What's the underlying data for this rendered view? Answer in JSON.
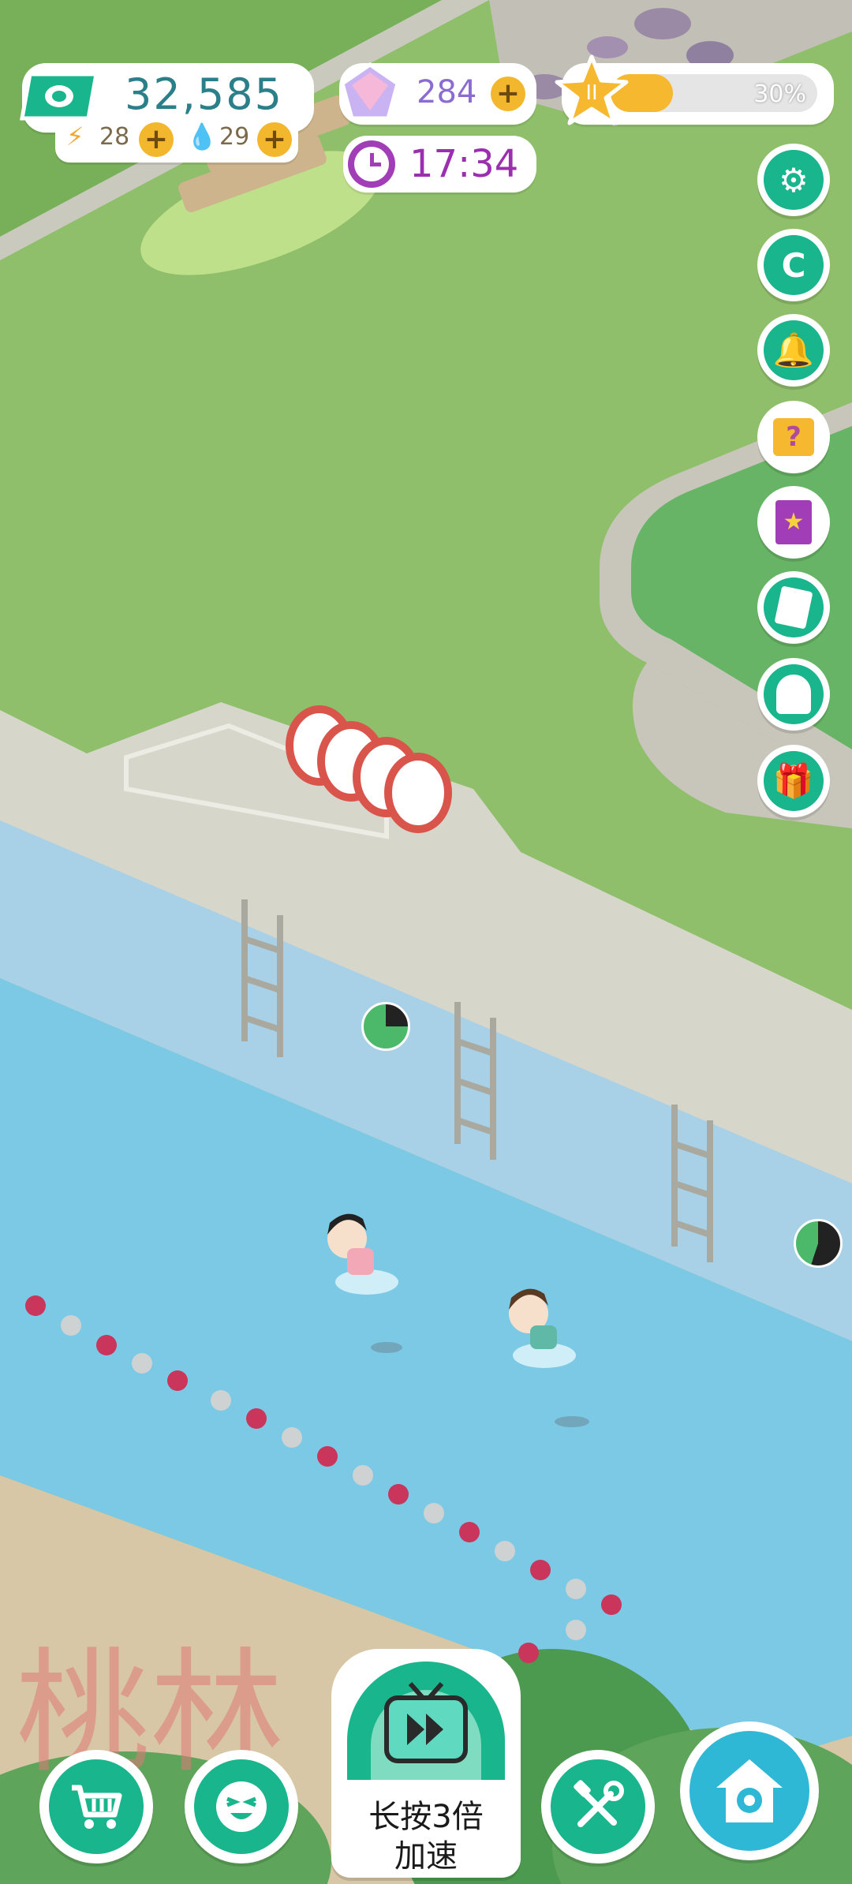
{
  "hud": {
    "money": "32,585",
    "energy": "28",
    "water": "29",
    "gems": "284",
    "clock": "17:34",
    "level_percent_text": "30%",
    "level_progress": 0.3
  },
  "side_buttons": [
    {
      "name": "settings-button",
      "icon": "gear-icon"
    },
    {
      "name": "community-button",
      "icon": "chat-c-icon"
    },
    {
      "name": "notification-button",
      "icon": "bell-icon"
    },
    {
      "name": "mystery-box-button",
      "icon": "mystery-box-icon"
    },
    {
      "name": "star-book-button",
      "icon": "star-book-icon"
    },
    {
      "name": "notes-button",
      "icon": "notepad-icon"
    },
    {
      "name": "ghost-button",
      "icon": "ghost-icon"
    },
    {
      "name": "gift-button",
      "icon": "gift-icon"
    }
  ],
  "bottom_bar": {
    "shop_icon": "cart-icon",
    "emoji_icon": "smile-icon",
    "speed_label_line1": "长按3倍",
    "speed_label_line2": "加速",
    "tools_icon": "tools-icon",
    "home_icon": "home-gear-icon"
  },
  "colors": {
    "accent": "#19b58d",
    "pool_water": "#7cc9e6",
    "grass": "#8fbf6a"
  }
}
